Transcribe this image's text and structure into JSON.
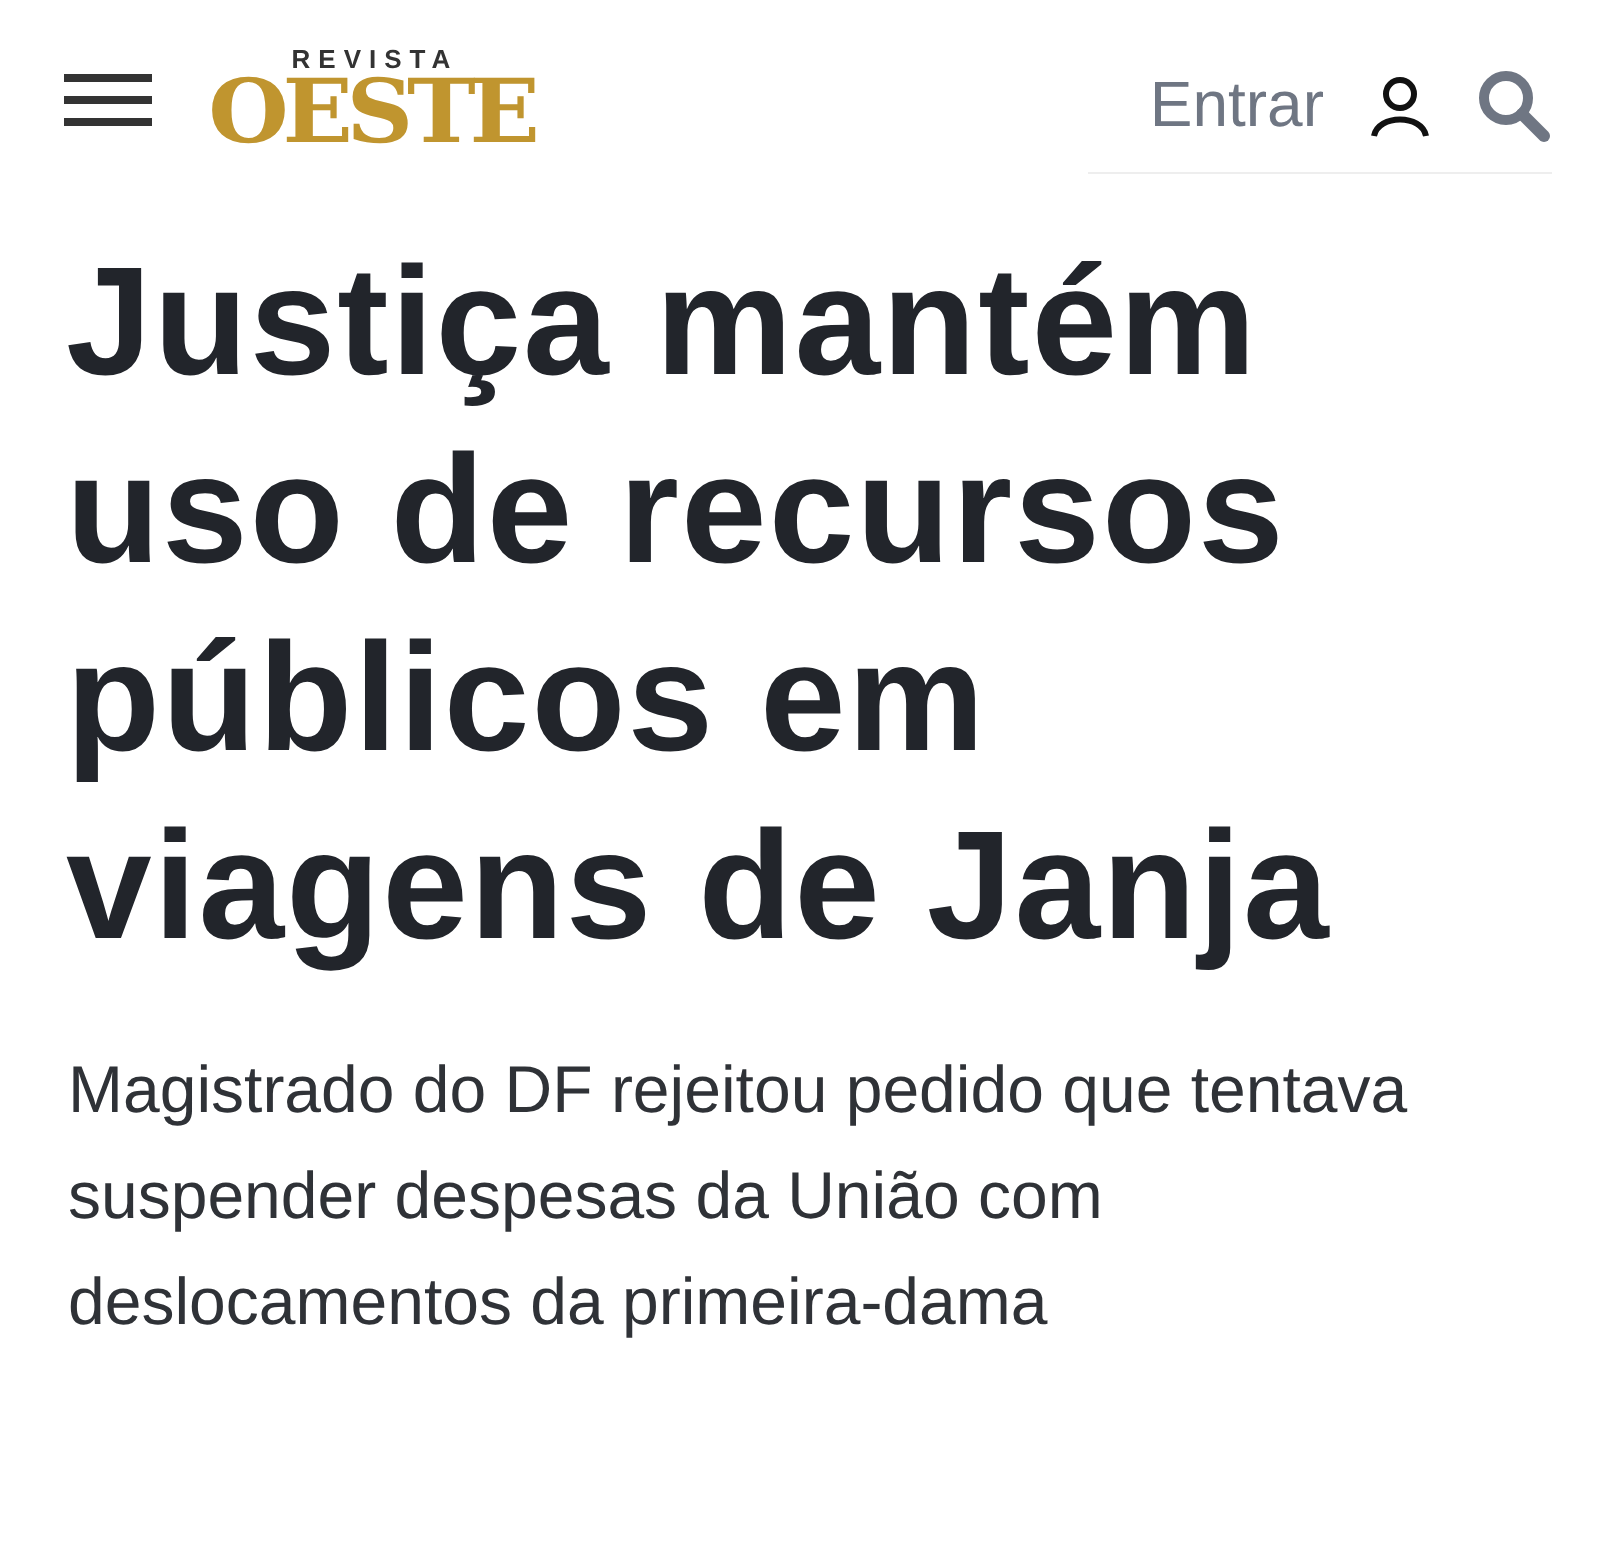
{
  "header": {
    "logo_top": "REVISTA",
    "logo_main": "OESTE",
    "login": "Entrar"
  },
  "article": {
    "headline": "Justiça mantém uso de recursos públicos em viagens de Janja",
    "subtitle": "Magistrado do DF rejeitou pedido que tentava suspender despesas da União com deslocamentos da primeira-dama"
  }
}
